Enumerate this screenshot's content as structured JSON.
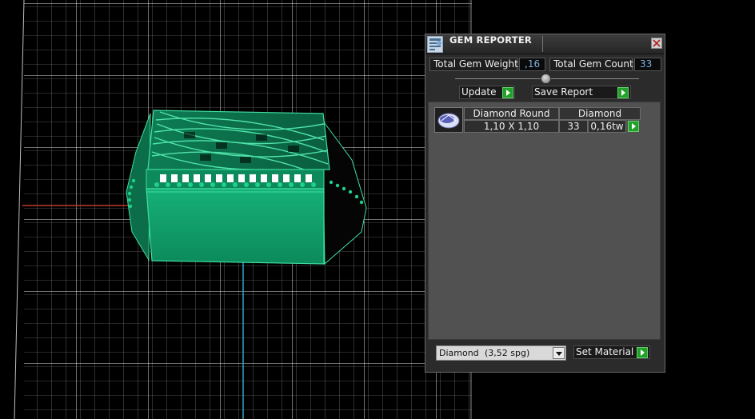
{
  "panel": {
    "title": "GEM REPORTER",
    "icon": "gem-report-icon",
    "close_icon": "close-icon",
    "total_weight_label": "Total Gem Weight",
    "total_weight_value": ",16",
    "total_count_label": "Total Gem Count",
    "total_count_value": "33",
    "update_label": "Update",
    "save_report_label": "Save Report",
    "set_material_label": "Set Material"
  },
  "gems": [
    {
      "shape": "Diamond Round",
      "material": "Diamond",
      "size": "1,10 X 1,10",
      "count": "33",
      "weight": "0,16tw"
    }
  ],
  "material_select": {
    "name": "Diamond",
    "spg": "(3,52 spg)"
  },
  "colors": {
    "model": "#0f9e6a",
    "model_edge": "#3fe0a0",
    "grid": "#cfcfcf",
    "x_axis": "#c0392b",
    "y_axis": "#2fa4c7",
    "button_arrow": "#21a12a",
    "value_text": "#7fb0e0"
  }
}
